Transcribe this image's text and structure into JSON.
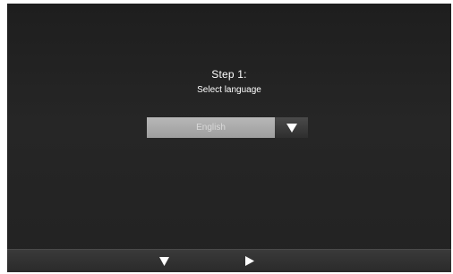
{
  "setup": {
    "step_title": "Step 1:",
    "step_subtitle": "Select language"
  },
  "language_select": {
    "selected": "English",
    "arrow_icon": "triangle-down-icon"
  },
  "footer": {
    "down_icon": "triangle-down-icon",
    "next_icon": "triangle-right-icon"
  },
  "colors": {
    "background": "#222222",
    "text": "#ffffff",
    "select_field": "#a8a8a8",
    "footer_bar": "#333333"
  }
}
